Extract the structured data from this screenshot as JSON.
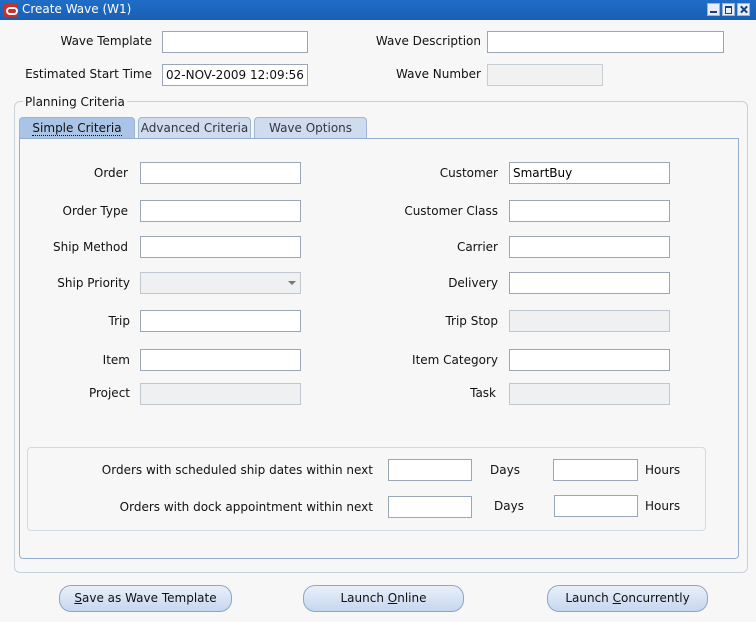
{
  "window": {
    "title": "Create Wave (W1)"
  },
  "header": {
    "wave_template_label": "Wave Template",
    "wave_template_value": "",
    "wave_description_label": "Wave Description",
    "wave_description_value": "",
    "est_start_label": "Estimated Start Time",
    "est_start_value": "02-NOV-2009 12:09:56",
    "wave_number_label": "Wave Number",
    "wave_number_value": ""
  },
  "planning": {
    "title": "Planning Criteria",
    "tabs": [
      {
        "label": "Simple Criteria",
        "active": true
      },
      {
        "label": "Advanced Criteria",
        "active": false
      },
      {
        "label": "Wave Options",
        "active": false
      }
    ]
  },
  "simple": {
    "order_label": "Order",
    "order_value": "",
    "order_type_label": "Order Type",
    "order_type_value": "",
    "ship_method_label": "Ship Method",
    "ship_method_value": "",
    "ship_priority_label": "Ship Priority",
    "ship_priority_value": "",
    "trip_label": "Trip",
    "trip_value": "",
    "item_label": "Item",
    "item_value": "",
    "project_label": "Project",
    "project_value": "",
    "customer_label": "Customer",
    "customer_value": "SmartBuy",
    "customer_class_label": "Customer Class",
    "customer_class_value": "",
    "carrier_label": "Carrier",
    "carrier_value": "",
    "delivery_label": "Delivery",
    "delivery_value": "",
    "trip_stop_label": "Trip Stop",
    "trip_stop_value": "",
    "item_category_label": "Item Category",
    "item_category_value": "",
    "task_label": "Task",
    "task_value": ""
  },
  "window_criteria": {
    "ship_dates_label": "Orders with scheduled ship dates within next",
    "dock_appt_label": "Orders with dock appointment within next",
    "days_label": "Days",
    "hours_label": "Hours",
    "ship_days_value": "",
    "ship_hours_value": "",
    "dock_days_value": "",
    "dock_hours_value": ""
  },
  "buttons": {
    "save_template": {
      "prefix": "",
      "mnemonic": "S",
      "rest": "ave as Wave Template"
    },
    "launch_online": {
      "prefix": "Launch ",
      "mnemonic": "O",
      "rest": "nline"
    },
    "launch_concurrently": {
      "prefix": "Launch ",
      "mnemonic": "C",
      "rest": "oncurrently"
    }
  },
  "colors": {
    "titlebar": "#1a5fb4",
    "tab_active": "#a9c4e6",
    "tab_inactive": "#cfdcee",
    "button": "#c6d7ee"
  }
}
